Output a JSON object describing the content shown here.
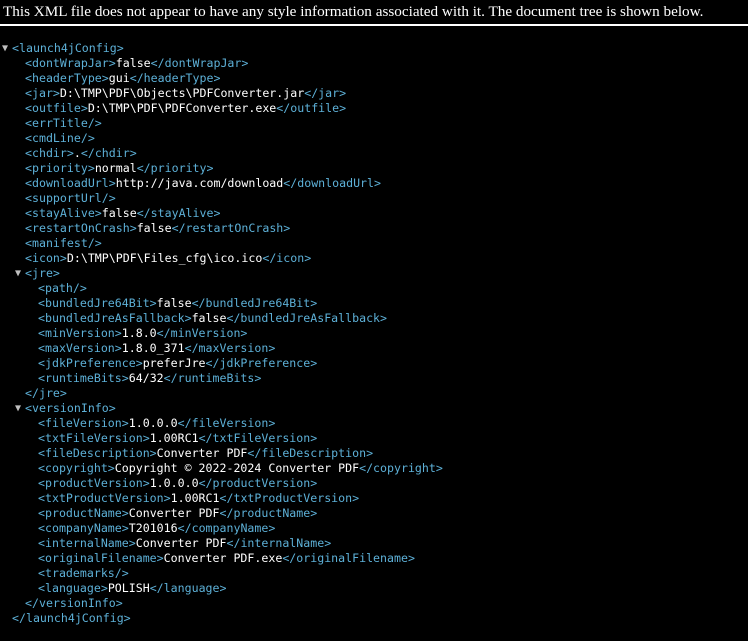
{
  "info_message": "This XML file does not appear to have any style information associated with it. The document tree is shown below.",
  "toggle_glyph": "▼",
  "tree": [
    {
      "indent": 0,
      "toggle": true,
      "open": "<launch4jConfig>"
    },
    {
      "indent": 1,
      "open": "<dontWrapJar>",
      "text": "false",
      "close": "</dontWrapJar>"
    },
    {
      "indent": 1,
      "open": "<headerType>",
      "text": "gui",
      "close": "</headerType>"
    },
    {
      "indent": 1,
      "open": "<jar>",
      "text": "D:\\TMP\\PDF\\Objects\\PDFConverter.jar",
      "close": "</jar>"
    },
    {
      "indent": 1,
      "open": "<outfile>",
      "text": "D:\\TMP\\PDF\\PDFConverter.exe",
      "close": "</outfile>"
    },
    {
      "indent": 1,
      "open": "<errTitle/>"
    },
    {
      "indent": 1,
      "open": "<cmdLine/>"
    },
    {
      "indent": 1,
      "open": "<chdir>",
      "text": ".",
      "close": "</chdir>"
    },
    {
      "indent": 1,
      "open": "<priority>",
      "text": "normal",
      "close": "</priority>"
    },
    {
      "indent": 1,
      "open": "<downloadUrl>",
      "text": "http://java.com/download",
      "close": "</downloadUrl>"
    },
    {
      "indent": 1,
      "open": "<supportUrl/>"
    },
    {
      "indent": 1,
      "open": "<stayAlive>",
      "text": "false",
      "close": "</stayAlive>"
    },
    {
      "indent": 1,
      "open": "<restartOnCrash>",
      "text": "false",
      "close": "</restartOnCrash>"
    },
    {
      "indent": 1,
      "open": "<manifest/>"
    },
    {
      "indent": 1,
      "open": "<icon>",
      "text": "D:\\TMP\\PDF\\Files_cfg\\ico.ico",
      "close": "</icon>"
    },
    {
      "indent": 1,
      "toggle": true,
      "open": "<jre>"
    },
    {
      "indent": 2,
      "open": "<path/>"
    },
    {
      "indent": 2,
      "open": "<bundledJre64Bit>",
      "text": "false",
      "close": "</bundledJre64Bit>"
    },
    {
      "indent": 2,
      "open": "<bundledJreAsFallback>",
      "text": "false",
      "close": "</bundledJreAsFallback>"
    },
    {
      "indent": 2,
      "open": "<minVersion>",
      "text": "1.8.0",
      "close": "</minVersion>"
    },
    {
      "indent": 2,
      "open": "<maxVersion>",
      "text": "1.8.0_371",
      "close": "</maxVersion>"
    },
    {
      "indent": 2,
      "open": "<jdkPreference>",
      "text": "preferJre",
      "close": "</jdkPreference>"
    },
    {
      "indent": 2,
      "open": "<runtimeBits>",
      "text": "64/32",
      "close": "</runtimeBits>"
    },
    {
      "indent": 1,
      "open": "</jre>"
    },
    {
      "indent": 1,
      "toggle": true,
      "open": "<versionInfo>"
    },
    {
      "indent": 2,
      "open": "<fileVersion>",
      "text": "1.0.0.0",
      "close": "</fileVersion>"
    },
    {
      "indent": 2,
      "open": "<txtFileVersion>",
      "text": "1.00RC1",
      "close": "</txtFileVersion>"
    },
    {
      "indent": 2,
      "open": "<fileDescription>",
      "text": "Converter PDF",
      "close": "</fileDescription>"
    },
    {
      "indent": 2,
      "open": "<copyright>",
      "text": "Copyright © 2022-2024 Converter PDF",
      "close": "</copyright>"
    },
    {
      "indent": 2,
      "open": "<productVersion>",
      "text": "1.0.0.0",
      "close": "</productVersion>"
    },
    {
      "indent": 2,
      "open": "<txtProductVersion>",
      "text": "1.00RC1",
      "close": "</txtProductVersion>"
    },
    {
      "indent": 2,
      "open": "<productName>",
      "text": "Converter PDF",
      "close": "</productName>"
    },
    {
      "indent": 2,
      "open": "<companyName>",
      "text": "T201016",
      "close": "</companyName>"
    },
    {
      "indent": 2,
      "open": "<internalName>",
      "text": "Converter PDF",
      "close": "</internalName>"
    },
    {
      "indent": 2,
      "open": "<originalFilename>",
      "text": "Converter PDF.exe",
      "close": "</originalFilename>"
    },
    {
      "indent": 2,
      "open": "<trademarks/>"
    },
    {
      "indent": 2,
      "open": "<language>",
      "text": "POLISH",
      "close": "</language>"
    },
    {
      "indent": 1,
      "open": "</versionInfo>"
    },
    {
      "indent": 0,
      "open": "</launch4jConfig>"
    }
  ]
}
